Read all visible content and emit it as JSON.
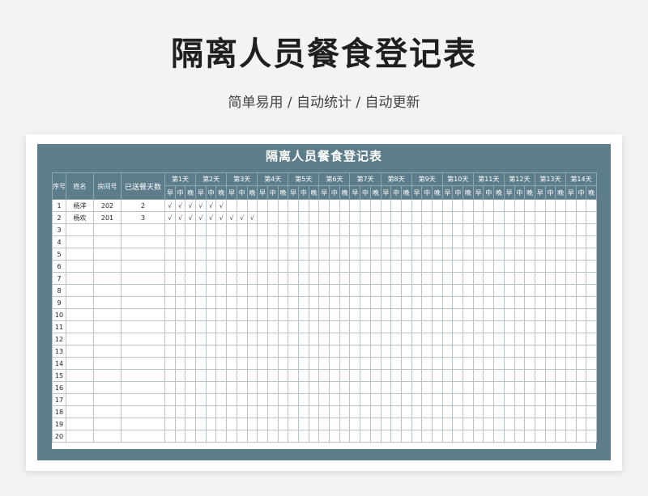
{
  "page": {
    "title": "隔离人员餐食登记表",
    "subtitle": "简单易用 / 自动统计 / 自动更新"
  },
  "sheet": {
    "title": "隔离人员餐食登记表",
    "headers": {
      "seq": "序号",
      "name": "姓名",
      "room": "房间号",
      "days": "已送餐天数"
    },
    "day_labels": [
      "第1天",
      "第2天",
      "第3天",
      "第4天",
      "第5天",
      "第6天",
      "第7天",
      "第8天",
      "第9天",
      "第10天",
      "第11天",
      "第12天",
      "第13天",
      "第14天"
    ],
    "meal_labels": [
      "早",
      "中",
      "晚"
    ],
    "check_mark": "√",
    "rows": [
      {
        "seq": "1",
        "name": "杨洋",
        "room": "202",
        "days": "2",
        "meals": [
          1,
          1,
          1,
          1,
          1,
          1,
          0,
          0,
          0,
          0,
          0,
          0,
          0,
          0,
          0,
          0,
          0,
          0,
          0,
          0,
          0,
          0,
          0,
          0,
          0,
          0,
          0,
          0,
          0,
          0,
          0,
          0,
          0,
          0,
          0,
          0,
          0,
          0,
          0,
          0,
          0,
          0
        ]
      },
      {
        "seq": "2",
        "name": "杨欢",
        "room": "201",
        "days": "3",
        "meals": [
          1,
          1,
          1,
          1,
          1,
          1,
          1,
          1,
          1,
          0,
          0,
          0,
          0,
          0,
          0,
          0,
          0,
          0,
          0,
          0,
          0,
          0,
          0,
          0,
          0,
          0,
          0,
          0,
          0,
          0,
          0,
          0,
          0,
          0,
          0,
          0,
          0,
          0,
          0,
          0,
          0,
          0
        ]
      },
      {
        "seq": "3",
        "name": "",
        "room": "",
        "days": "",
        "meals": []
      },
      {
        "seq": "4",
        "name": "",
        "room": "",
        "days": "",
        "meals": []
      },
      {
        "seq": "5",
        "name": "",
        "room": "",
        "days": "",
        "meals": []
      },
      {
        "seq": "6",
        "name": "",
        "room": "",
        "days": "",
        "meals": []
      },
      {
        "seq": "7",
        "name": "",
        "room": "",
        "days": "",
        "meals": []
      },
      {
        "seq": "8",
        "name": "",
        "room": "",
        "days": "",
        "meals": []
      },
      {
        "seq": "9",
        "name": "",
        "room": "",
        "days": "",
        "meals": []
      },
      {
        "seq": "10",
        "name": "",
        "room": "",
        "days": "",
        "meals": []
      },
      {
        "seq": "11",
        "name": "",
        "room": "",
        "days": "",
        "meals": []
      },
      {
        "seq": "12",
        "name": "",
        "room": "",
        "days": "",
        "meals": []
      },
      {
        "seq": "13",
        "name": "",
        "room": "",
        "days": "",
        "meals": []
      },
      {
        "seq": "14",
        "name": "",
        "room": "",
        "days": "",
        "meals": []
      },
      {
        "seq": "15",
        "name": "",
        "room": "",
        "days": "",
        "meals": []
      },
      {
        "seq": "16",
        "name": "",
        "room": "",
        "days": "",
        "meals": []
      },
      {
        "seq": "17",
        "name": "",
        "room": "",
        "days": "",
        "meals": []
      },
      {
        "seq": "18",
        "name": "",
        "room": "",
        "days": "",
        "meals": []
      },
      {
        "seq": "19",
        "name": "",
        "room": "",
        "days": "",
        "meals": []
      },
      {
        "seq": "20",
        "name": "",
        "room": "",
        "days": "",
        "meals": []
      }
    ]
  },
  "colors": {
    "header_bg": "#5d7d8b",
    "grid_line": "#b9c3c8",
    "page_bg": "#f2f3f5"
  }
}
